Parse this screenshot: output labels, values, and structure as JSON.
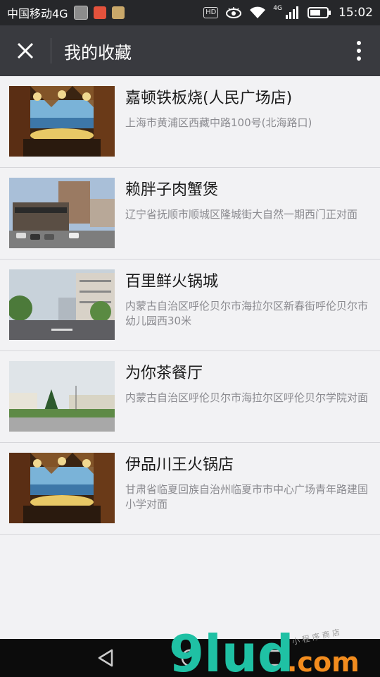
{
  "status_bar": {
    "carrier": "中国移动4G",
    "hd": "HD",
    "network": "4G",
    "time": "15:02"
  },
  "header": {
    "close_icon": "close-icon",
    "title": "我的收藏",
    "more_icon": "more-vertical-icon"
  },
  "favorites": [
    {
      "name": "嘉顿铁板烧(人民广场店)",
      "address": "上海市黄浦区西藏中路100号(北海路口)",
      "thumbnail": "restaurant-interior"
    },
    {
      "name": "赖胖子肉蟹煲",
      "address": "辽宁省抚顺市顺城区隆城街大自然一期西门正对面",
      "thumbnail": "street-buildings"
    },
    {
      "name": "百里鲜火锅城",
      "address": "内蒙古自治区呼伦贝尔市海拉尔区新春街呼伦贝尔市幼儿园西30米",
      "thumbnail": "street-trees"
    },
    {
      "name": "为你茶餐厅",
      "address": "内蒙古自治区呼伦贝尔市海拉尔区呼伦贝尔学院对面",
      "thumbnail": "campus-square"
    },
    {
      "name": "伊品川王火锅店",
      "address": "甘肃省临夏回族自治州临夏市市中心广场青年路建国小学对面",
      "thumbnail": "restaurant-interior"
    }
  ],
  "watermark": {
    "brand": "9lud",
    "suffix": ".com",
    "tagline": "小 程 序 商 店"
  },
  "nav_bar": {
    "back_icon": "back-triangle-icon",
    "home_icon": "home-circle-icon",
    "recents_icon": "recents-square-icon"
  }
}
